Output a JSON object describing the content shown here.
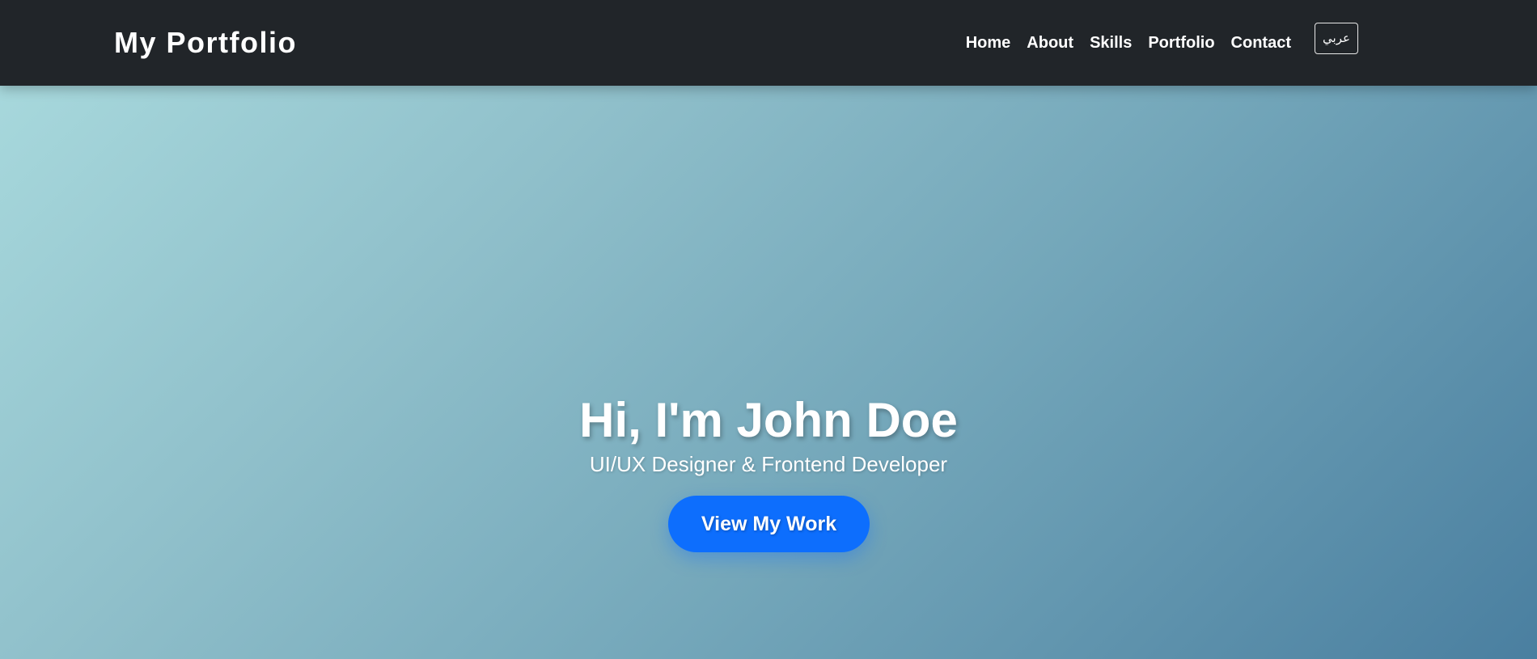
{
  "navbar": {
    "brand": "My Portfolio",
    "links": [
      {
        "label": "Home"
      },
      {
        "label": "About"
      },
      {
        "label": "Skills"
      },
      {
        "label": "Portfolio"
      },
      {
        "label": "Contact"
      }
    ],
    "language_button": "عربي"
  },
  "hero": {
    "title": "Hi, I'm John Doe",
    "subtitle": "UI/UX Designer & Frontend Developer",
    "cta_label": "View My Work"
  },
  "colors": {
    "navbar_background": "#212529",
    "cta_background": "#0d6efd",
    "hero_gradient_start": "#a7d8dc",
    "hero_gradient_end": "#4a7fa0"
  }
}
